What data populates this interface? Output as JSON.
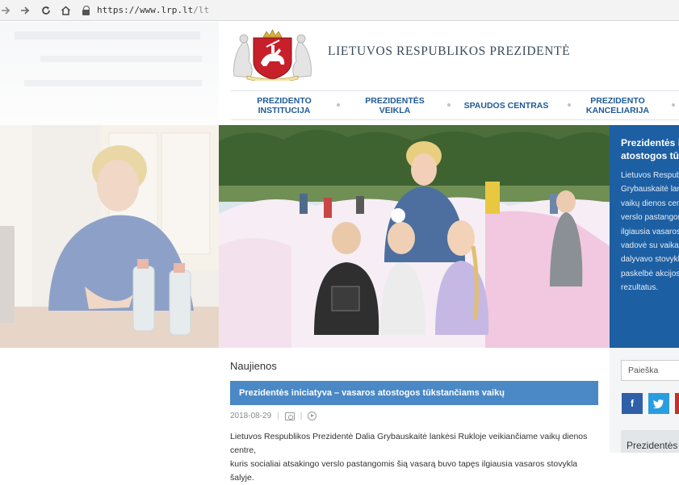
{
  "browser": {
    "url_prefix": "https://www.lrp.lt",
    "url_path": "/lt"
  },
  "header": {
    "site_title": "LIETUVOS RESPUBLIKOS PREZIDENTĖ"
  },
  "nav": {
    "items": [
      {
        "label": "PREZIDENTO INSTITUCIJA"
      },
      {
        "label": "PREZIDENTĖS VEIKLA"
      },
      {
        "label": "SPAUDOS CENTRAS"
      },
      {
        "label": "PREZIDENTO KANCELIARIJA"
      }
    ]
  },
  "hero": {
    "title_line1": "Prezidentės i",
    "title_line2": "atostogos tūk",
    "body_lines": [
      "Lietuvos Respub",
      "Grybauskaitė lan",
      "vaikų dienos cen",
      "verslo pastangon",
      "ilgiausia vasaros",
      "vadovė su vaikai",
      "dalyvavo stovykl",
      "paskelbė akcijos",
      "rezultatus."
    ]
  },
  "news": {
    "heading": "Naujienos",
    "featured_title": "Prezidentės iniciatyva – vasaros atostogos tūkstančiams vaikų",
    "date": "2018-08-29",
    "text_line1": "Lietuvos Respublikos Prezidentė Dalia Grybauskaitė lankėsi Rukloje veikiančiame vaikų dienos centre,",
    "text_line2": "kuris socialiai atsakingo verslo pastangomis šią vasarą buvo tapęs ilgiausia vasaros stovykla šalyje."
  },
  "sidebar": {
    "search_placeholder": "Paieška",
    "facebook": "f",
    "twitter": "🐦",
    "panel_title": "Prezidentės"
  },
  "colors": {
    "nav_text": "#1f5a96",
    "hero_blue": "#1d5fa3",
    "news_bar": "#4a88c6",
    "facebook": "#2f5fa8",
    "twitter": "#2a9de0",
    "youtube": "#c4302b"
  }
}
